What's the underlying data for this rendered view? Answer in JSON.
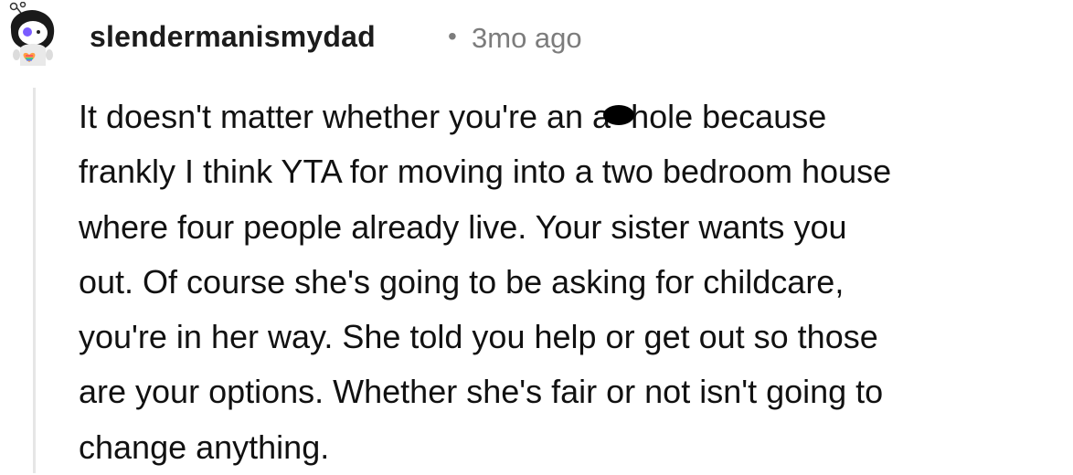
{
  "comment": {
    "author": "slendermanismydad",
    "separator": "•",
    "timestamp": "3mo ago",
    "avatar_icon": "snoo-avatar-icon",
    "body_lines": [
      "It doesn't matter whether you're an a",
      "hole because",
      "frankly I think YTA for moving into a two bedroom house",
      "where four people already live. Your sister wants you",
      "out. Of course she's going to be asking for childcare,",
      "you're in her way. She told you help or get out so those",
      "are your options. Whether she's fair or not isn't going to",
      "change anything."
    ]
  },
  "colors": {
    "username": "#1c1c1c",
    "meta": "#7c7c7c",
    "thread_line": "#e6e6e6",
    "body": "#111111"
  }
}
